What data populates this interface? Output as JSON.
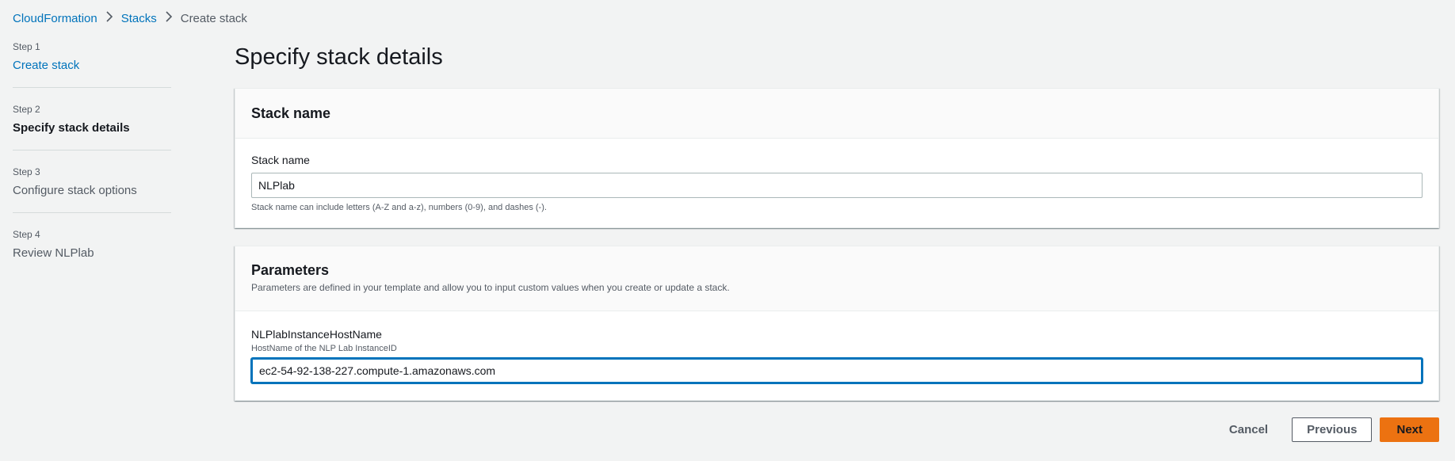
{
  "breadcrumb": {
    "items": [
      "CloudFormation",
      "Stacks"
    ],
    "current": "Create stack"
  },
  "steps": [
    {
      "num": "Step 1",
      "title": "Create stack"
    },
    {
      "num": "Step 2",
      "title": "Specify stack details"
    },
    {
      "num": "Step 3",
      "title": "Configure stack options"
    },
    {
      "num": "Step 4",
      "title": "Review NLPlab"
    }
  ],
  "page_title": "Specify stack details",
  "stack_name_panel": {
    "header": "Stack name",
    "label": "Stack name",
    "value": "NLPlab",
    "constraint": "Stack name can include letters (A-Z and a-z), numbers (0-9), and dashes (-)."
  },
  "parameters_panel": {
    "header": "Parameters",
    "description": "Parameters are defined in your template and allow you to input custom values when you create or update a stack.",
    "param_label": "NLPlabInstanceHostName",
    "param_desc": "HostName of the NLP Lab InstanceID",
    "param_value": "ec2-54-92-138-227.compute-1.amazonaws.com"
  },
  "actions": {
    "cancel": "Cancel",
    "previous": "Previous",
    "next": "Next"
  },
  "colors": {
    "link": "#0073bb",
    "primary_button": "#ec7211",
    "background": "#f2f3f3"
  }
}
